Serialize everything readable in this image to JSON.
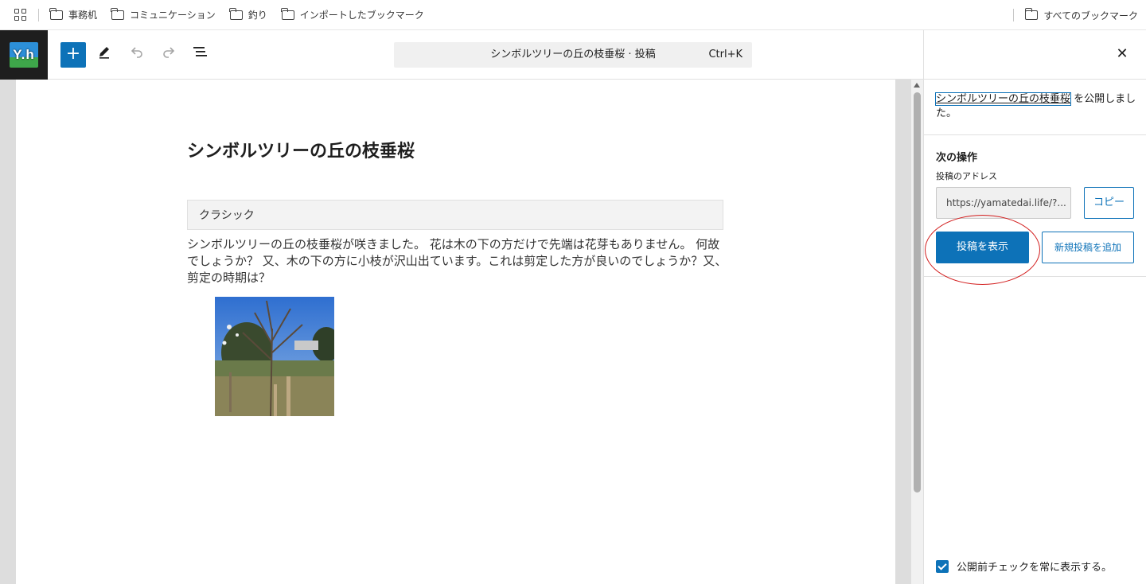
{
  "bookmarks": {
    "items": [
      {
        "label": "事務机"
      },
      {
        "label": "コミュニケーション"
      },
      {
        "label": "釣り"
      },
      {
        "label": "インポートしたブックマーク"
      }
    ],
    "all_label": "すべてのブックマーク"
  },
  "toolbar": {
    "site_logo_text": "Y.h",
    "inserter_label": "+",
    "doc_title": "シンボルツリーの丘の枝垂桜 · 投稿",
    "shortcut": "Ctrl+K"
  },
  "editor": {
    "post_title": "シンボルツリーの丘の枝垂桜",
    "classic_block_label": "クラシック",
    "body_text": "シンボルツリーの丘の枝垂桜が咲きました。 花は木の下の方だけで先端は花芽もありません。 何故でしょうか？ 又、木の下の方に小枝が沢山出ています。これは剪定した方が良いのでしょうか？又、剪定の時期は？"
  },
  "sidebar": {
    "published_link": "シンボルツリーの丘の枝垂桜",
    "published_suffix": " を公開しました。",
    "next_heading": "次の操作",
    "address_label": "投稿のアドレス",
    "address_value": "https://yamatedai.life/?...",
    "copy_label": "コピー",
    "view_post_label": "投稿を表示",
    "add_new_label": "新規投稿を追加",
    "prepublish_label": "公開前チェックを常に表示する。",
    "prepublish_checked": true
  },
  "colors": {
    "accent": "#0d72b8",
    "annotation": "#d32020"
  }
}
